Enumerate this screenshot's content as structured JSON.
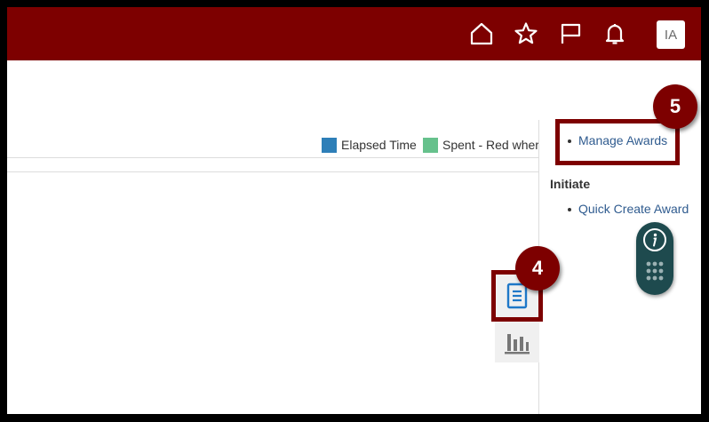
{
  "header": {
    "icons": [
      "home-icon",
      "star-icon",
      "flag-icon",
      "bell-icon"
    ],
    "avatar_initials": "IA"
  },
  "legend": {
    "items": [
      {
        "label": "Elapsed Time",
        "color": "#2e7fb8"
      },
      {
        "label": "Spent - Red wher",
        "color": "#66c18c"
      }
    ]
  },
  "sidebar": {
    "links_top": [
      {
        "label": "Manage Awards"
      }
    ],
    "initiate_heading": "Initiate",
    "initiate_links": [
      {
        "label": "Quick Create Award"
      }
    ]
  },
  "callouts": {
    "manage_awards": "5",
    "view_toggle": "4"
  },
  "colors": {
    "brand": "#7d0000",
    "link": "#2f5b8f",
    "helper_bg": "#1e4a4e"
  }
}
